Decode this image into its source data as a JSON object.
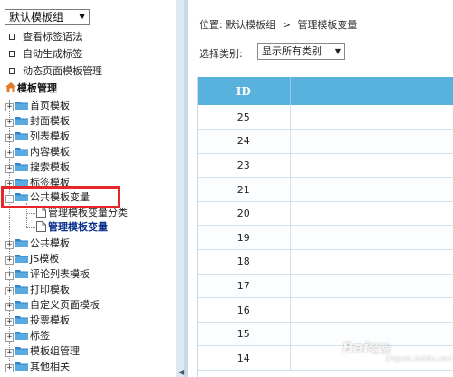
{
  "left_panel": {
    "group_select": {
      "value": "默认模板组"
    },
    "tools": [
      {
        "label": "查看标签语法"
      },
      {
        "label": "自动生成标签"
      },
      {
        "label": "动态页面模板管理"
      }
    ],
    "tree": {
      "root_label": "模板管理",
      "nodes": [
        {
          "label": "首页模板",
          "expander": "+"
        },
        {
          "label": "封面模板",
          "expander": "+"
        },
        {
          "label": "列表模板",
          "expander": "+"
        },
        {
          "label": "内容模板",
          "expander": "+"
        },
        {
          "label": "搜索模板",
          "expander": "+"
        },
        {
          "label": "标签模板",
          "expander": "+"
        },
        {
          "label": "公共模板变量",
          "expander": "-",
          "highlighted": true,
          "children": [
            {
              "label": "管理模板变量分类"
            },
            {
              "label": "管理模板变量",
              "active": true
            }
          ]
        },
        {
          "label": "公共模板",
          "expander": "+"
        },
        {
          "label": "JS模板",
          "expander": "+"
        },
        {
          "label": "评论列表模板",
          "expander": "+"
        },
        {
          "label": "打印模板",
          "expander": "+"
        },
        {
          "label": "自定义页面模板",
          "expander": "+"
        },
        {
          "label": "投票模板",
          "expander": "+"
        },
        {
          "label": "标签",
          "expander": "+"
        },
        {
          "label": "模板组管理",
          "expander": "+"
        },
        {
          "label": "其他相关",
          "expander": "+"
        }
      ]
    }
  },
  "main": {
    "breadcrumb": {
      "prefix": "位置:",
      "group": "默认模板组",
      "separator": ">",
      "page": "管理模板变量"
    },
    "filter": {
      "label": "选择类别:",
      "value": "显示所有类别"
    },
    "table": {
      "columns": [
        "ID",
        ""
      ],
      "rows": [
        {
          "id": "25"
        },
        {
          "id": "24"
        },
        {
          "id": "23"
        },
        {
          "id": "21"
        },
        {
          "id": "20"
        },
        {
          "id": "19"
        },
        {
          "id": "18"
        },
        {
          "id": "17"
        },
        {
          "id": "16"
        },
        {
          "id": "15"
        },
        {
          "id": "14"
        }
      ]
    }
  },
  "watermark": {
    "brand": "Bai",
    "suffix": "经验",
    "url": "jingyan.baidu.com"
  },
  "colors": {
    "header_bg": "#59b1de",
    "highlight_border": "#e8262a",
    "divider_bg": "#dde9f3",
    "active_link": "#0a2f8a"
  },
  "icons": [
    "chevron-down-icon",
    "checkbox-icon",
    "house-icon",
    "folder-icon",
    "document-icon",
    "expand-icon",
    "collapse-icon"
  ]
}
